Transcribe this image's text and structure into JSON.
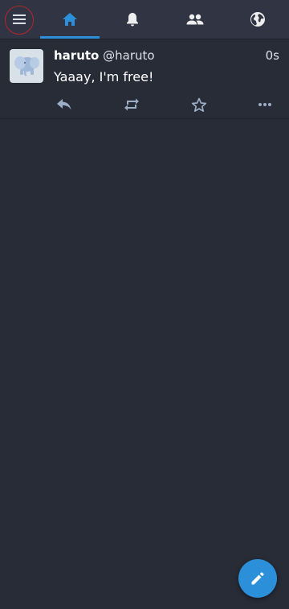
{
  "colors": {
    "background": "#282c37",
    "topbar": "#313543",
    "accent": "#2b90d9",
    "icon_muted": "#d9e1e8",
    "action_icon": "#9baec8",
    "highlight_ring": "#b3262d"
  },
  "topbar": {
    "menu_icon": "hamburger-menu-icon",
    "tabs": [
      {
        "id": "home",
        "icon": "home-icon",
        "active": true
      },
      {
        "id": "notifications",
        "icon": "bell-icon",
        "active": false
      },
      {
        "id": "local",
        "icon": "people-icon",
        "active": false
      },
      {
        "id": "federated",
        "icon": "globe-icon",
        "active": false
      }
    ]
  },
  "timeline": {
    "statuses": [
      {
        "display_name": "haruto",
        "acct": "@haruto",
        "time": "0s",
        "content": "Yaaay, I'm free!",
        "actions": [
          "reply-icon",
          "boost-icon",
          "favourite-icon",
          "more-icon"
        ]
      }
    ]
  },
  "compose_button": {
    "icon": "pencil-icon"
  }
}
